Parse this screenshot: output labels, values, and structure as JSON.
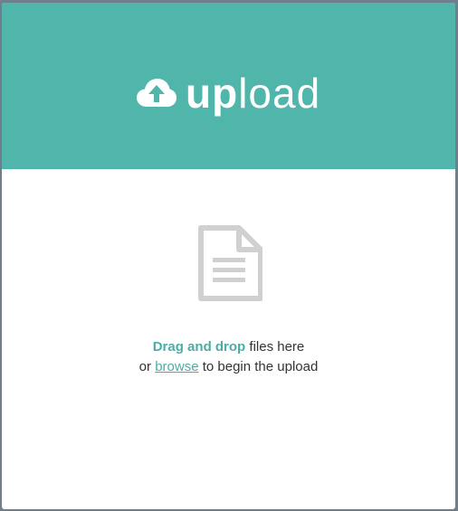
{
  "brand": {
    "title_bold": "up",
    "title_light": "load"
  },
  "dropzone": {
    "line1_accent": "Drag and drop",
    "line1_rest": " files here",
    "line2_prefix": "or ",
    "browse_link": "browse",
    "line2_suffix": " to begin the upload"
  },
  "icons": {
    "brand_icon": "cloud-upload-icon",
    "file_icon": "document-icon"
  },
  "colors": {
    "header_bg": "#50b5ab",
    "accent_text": "#4aaea4",
    "icon_gray": "#d0d0d0"
  }
}
